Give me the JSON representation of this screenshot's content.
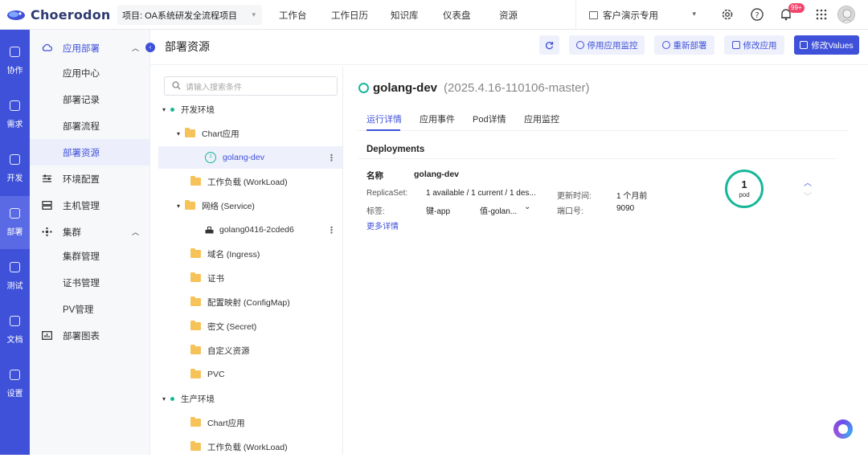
{
  "topbar": {
    "logo": "Choerodon",
    "project": "项目: OA系统研发全流程项目",
    "nav": [
      "工作台",
      "工作日历",
      "知识库",
      "仪表盘",
      "资源"
    ],
    "org": "客户演示专用",
    "notif_badge": "99+"
  },
  "rail": [
    {
      "label": "协作",
      "active": false
    },
    {
      "label": "需求",
      "active": false
    },
    {
      "label": "开发",
      "active": false
    },
    {
      "label": "部署",
      "active": true
    },
    {
      "label": "测试",
      "active": false
    },
    {
      "label": "文档",
      "active": false
    },
    {
      "label": "设置",
      "active": false
    }
  ],
  "sidebar": {
    "items": [
      {
        "label": "应用部署"
      },
      {
        "label": "应用中心"
      },
      {
        "label": "部署记录"
      },
      {
        "label": "部署流程"
      },
      {
        "label": "部署资源"
      },
      {
        "label": "环境配置"
      },
      {
        "label": "主机管理"
      },
      {
        "label": "集群"
      },
      {
        "label": "集群管理"
      },
      {
        "label": "证书管理"
      },
      {
        "label": "PV管理"
      },
      {
        "label": "部署图表"
      }
    ]
  },
  "header": {
    "title": "部署资源",
    "buttons": [
      "停用应用监控",
      "重新部署",
      "修改应用",
      "修改Values"
    ]
  },
  "tree": {
    "search_placeholder": "请输入搜索条件",
    "nodes": [
      {
        "label": "开发环境"
      },
      {
        "label": "Chart应用"
      },
      {
        "label": "golang-dev"
      },
      {
        "label": "工作负载 (WorkLoad)"
      },
      {
        "label": "网络 (Service)"
      },
      {
        "label": "golang0416-2cded6"
      },
      {
        "label": "域名 (Ingress)"
      },
      {
        "label": "证书"
      },
      {
        "label": "配置映射 (ConfigMap)"
      },
      {
        "label": "密文 (Secret)"
      },
      {
        "label": "自定义资源"
      },
      {
        "label": "PVC"
      },
      {
        "label": "生产环境"
      },
      {
        "label": "Chart应用"
      },
      {
        "label": "工作负载 (WorkLoad)"
      }
    ]
  },
  "detail": {
    "name": "golang-dev",
    "version": "(2025.4.16-110106-master)",
    "tabs": [
      "运行详情",
      "应用事件",
      "Pod详情",
      "应用监控"
    ],
    "section": "Deployments",
    "fields": {
      "name_key": "名称",
      "name_val": "golang-dev",
      "rs_key": "ReplicaSet:",
      "rs_val": "1 available / 1 current / 1 des...",
      "updated_key": "更新时间:",
      "updated_val": "1 个月前",
      "label_key": "标签:",
      "label_val1": "键-app",
      "label_val2": "值-golan...",
      "port_key": "端口号:",
      "port_val": "9090"
    },
    "more": "更多详情",
    "pod_count": "1",
    "pod_unit": "pod"
  }
}
